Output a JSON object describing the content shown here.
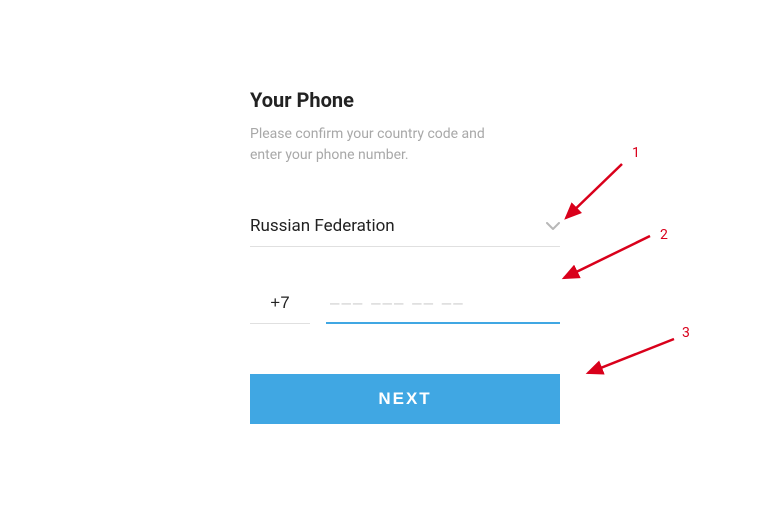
{
  "title": "Your Phone",
  "subtitle": "Please confirm your country code and enter your phone number.",
  "country": {
    "selected": "Russian Federation"
  },
  "phone": {
    "code": "+7",
    "number": "",
    "placeholder": "––– ––– –– ––"
  },
  "button": {
    "next": "NEXT"
  },
  "annotations": {
    "a1": "1",
    "a2": "2",
    "a3": "3"
  }
}
